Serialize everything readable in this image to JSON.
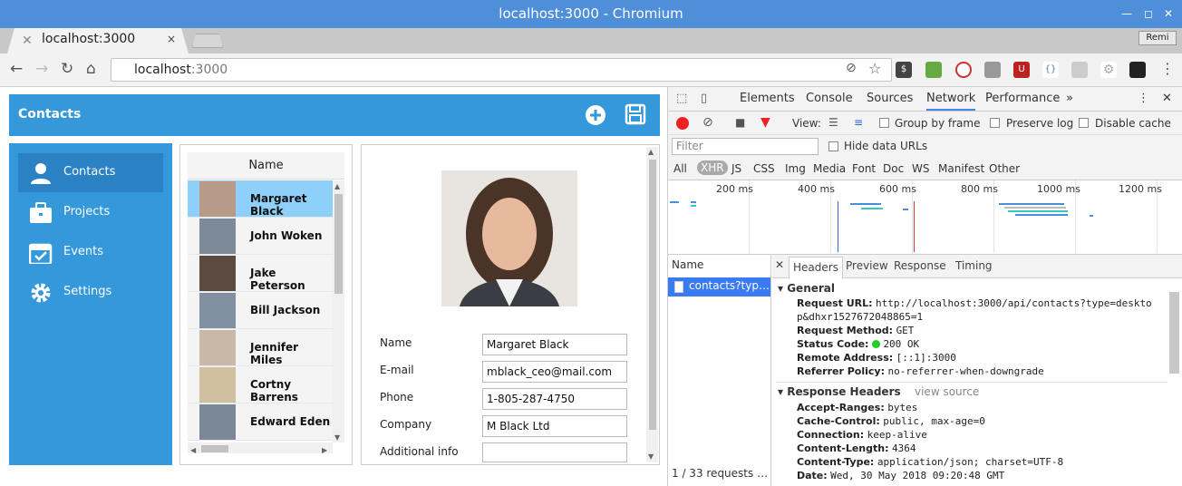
{
  "window": {
    "title": "localhost:3000 - Chromium"
  },
  "tab": {
    "title": "localhost:3000",
    "close": "×"
  },
  "profile": {
    "label": "Remi"
  },
  "toolbar": {
    "url_host": "localhost",
    "url_port": ":3000"
  },
  "app": {
    "header_title": "Contacts",
    "sidebar": {
      "items": [
        {
          "label": "Contacts",
          "icon": "user-icon"
        },
        {
          "label": "Projects",
          "icon": "briefcase-icon"
        },
        {
          "label": "Events",
          "icon": "calendar-icon"
        },
        {
          "label": "Settings",
          "icon": "gear-icon"
        }
      ]
    },
    "list": {
      "header": "Name",
      "rows": [
        "Margaret Black",
        "John Woken",
        "Jake Peterson",
        "Bill Jackson",
        "Jennifer Miles",
        "Cortny Barrens",
        "Edward Eden"
      ]
    },
    "form": {
      "name_label": "Name",
      "name_value": "Margaret Black",
      "email_label": "E-mail",
      "email_value": "mblack_ceo@mail.com",
      "phone_label": "Phone",
      "phone_value": "1-805-287-4750",
      "company_label": "Company",
      "company_value": "M Black Ltd",
      "info_label": "Additional info",
      "info_value": ""
    }
  },
  "devtools": {
    "tabs": [
      "Elements",
      "Console",
      "Sources",
      "Network",
      "Performance"
    ],
    "more": "»",
    "view_label": "View:",
    "group_by_frame": "Group by frame",
    "preserve_log": "Preserve log",
    "disable_cache": "Disable cache",
    "filter_placeholder": "Filter",
    "hide_data_urls": "Hide data URLs",
    "types": [
      "All",
      "XHR",
      "JS",
      "CSS",
      "Img",
      "Media",
      "Font",
      "Doc",
      "WS",
      "Manifest",
      "Other"
    ],
    "timeline_ticks": [
      "200 ms",
      "400 ms",
      "600 ms",
      "800 ms",
      "1000 ms",
      "1200 ms"
    ],
    "name_header": "Name",
    "request_name": "contacts?typ…",
    "request_count": "1 / 33 requests …",
    "subtabs": [
      "Headers",
      "Preview",
      "Response",
      "Timing"
    ],
    "general": {
      "title": "General",
      "request_url_label": "Request URL:",
      "request_url_value_1": "http://localhost:3000/api/contacts?type=deskto",
      "request_url_value_2": "p&dhxr1527672048865=1",
      "request_method_label": "Request Method:",
      "request_method_value": "GET",
      "status_code_label": "Status Code:",
      "status_code_value": "200 OK",
      "remote_address_label": "Remote Address:",
      "remote_address_value": "[::1]:3000",
      "referrer_label": "Referrer Policy:",
      "referrer_value": "no-referrer-when-downgrade"
    },
    "response_headers": {
      "title": "Response Headers",
      "view_source": "view source",
      "items": [
        {
          "k": "Accept-Ranges:",
          "v": "bytes"
        },
        {
          "k": "Cache-Control:",
          "v": "public, max-age=0"
        },
        {
          "k": "Connection:",
          "v": "keep-alive"
        },
        {
          "k": "Content-Length:",
          "v": "4364"
        },
        {
          "k": "Content-Type:",
          "v": "application/json; charset=UTF-8"
        },
        {
          "k": "Date:",
          "v": "Wed, 30 May 2018 09:20:48 GMT"
        }
      ]
    }
  },
  "colors": {
    "accent": "#3498db",
    "selected_row": "#8fd0fa",
    "devtools_blue": "#4285f4"
  }
}
